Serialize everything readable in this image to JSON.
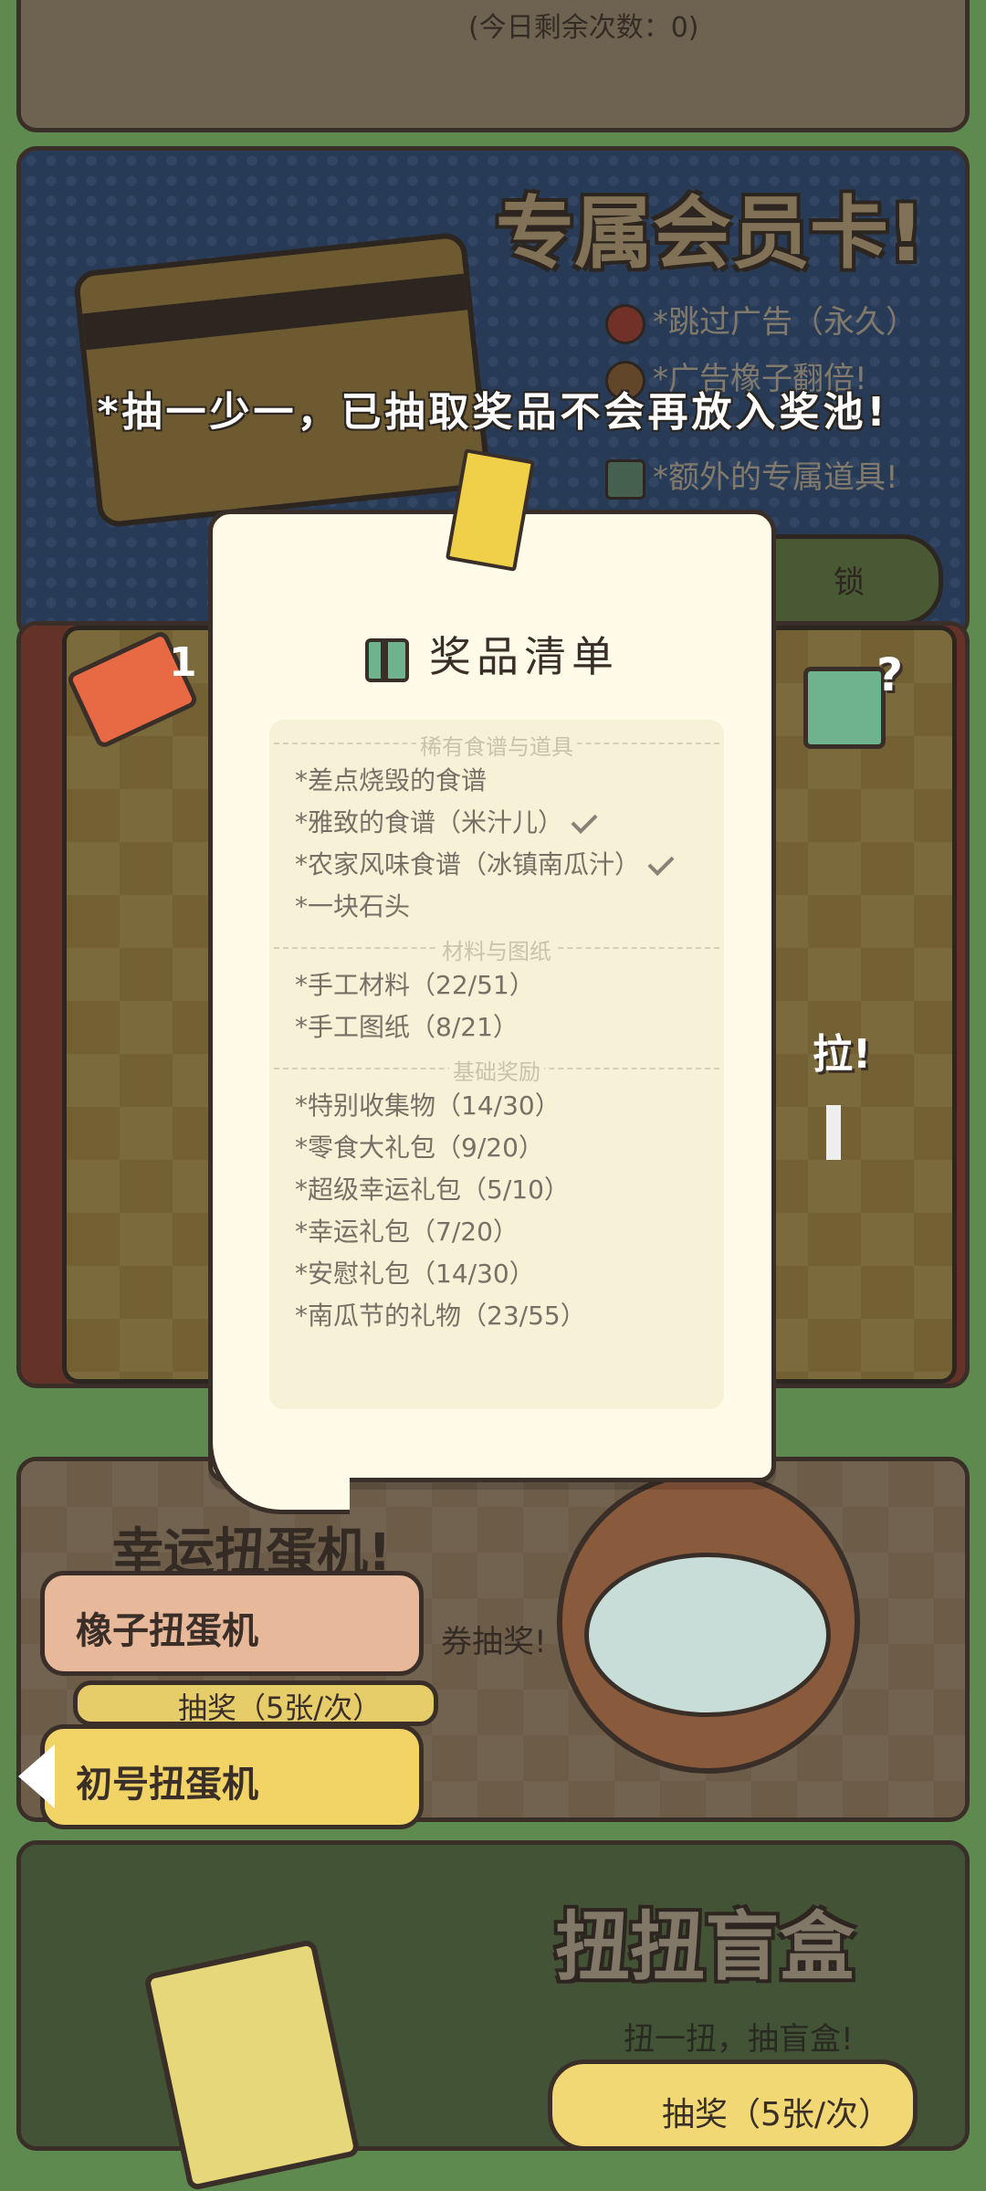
{
  "top_panel": {
    "remaining": "(今日剩余次数：0)"
  },
  "member_card": {
    "title": "专属会员卡!",
    "perks": [
      "*跳过广告（永久）",
      "*广告橡子翻倍!",
      "*额外的专属道具!"
    ],
    "unlock_label": "锁"
  },
  "notice": "*抽一少一，已抽取奖品不会再放入奖池!",
  "checker_panel": {
    "ticket_count": "1",
    "pull_label": "拉!"
  },
  "prize_popup": {
    "title": "奖品清单",
    "sections": [
      {
        "header": "稀有食谱与道具",
        "items": [
          {
            "label": "*差点烧毁的食谱",
            "done": false
          },
          {
            "label": "*雅致的食谱（米汁儿）",
            "done": true
          },
          {
            "label": "*农家风味食谱（冰镇南瓜汁）",
            "done": true
          },
          {
            "label": "*一块石头",
            "done": false
          }
        ]
      },
      {
        "header": "材料与图纸",
        "items": [
          {
            "label": "*手工材料（22/51）",
            "done": false
          },
          {
            "label": "*手工图纸（8/21）",
            "done": false
          }
        ]
      },
      {
        "header": "基础奖励",
        "items": [
          {
            "label": "*特别收集物（14/30）",
            "done": false
          },
          {
            "label": "*零食大礼包（9/20）",
            "done": false
          },
          {
            "label": "*超级幸运礼包（5/10）",
            "done": false
          },
          {
            "label": "*幸运礼包（7/20）",
            "done": false
          },
          {
            "label": "*安慰礼包（14/30）",
            "done": false
          },
          {
            "label": "*南瓜节的礼物（23/55）",
            "done": false
          }
        ]
      }
    ]
  },
  "gacha_panel": {
    "title": "幸运扭蛋机!",
    "subtitle": "券抽奖!",
    "tabs": [
      "橡子扭蛋机",
      "初号扭蛋机"
    ],
    "draw_label": "抽奖（5张/次）"
  },
  "blind_box": {
    "title": "扭扭盲盒",
    "subtitle": "扭一扭，抽盲盒!",
    "draw_button": "抽奖（5张/次）"
  }
}
